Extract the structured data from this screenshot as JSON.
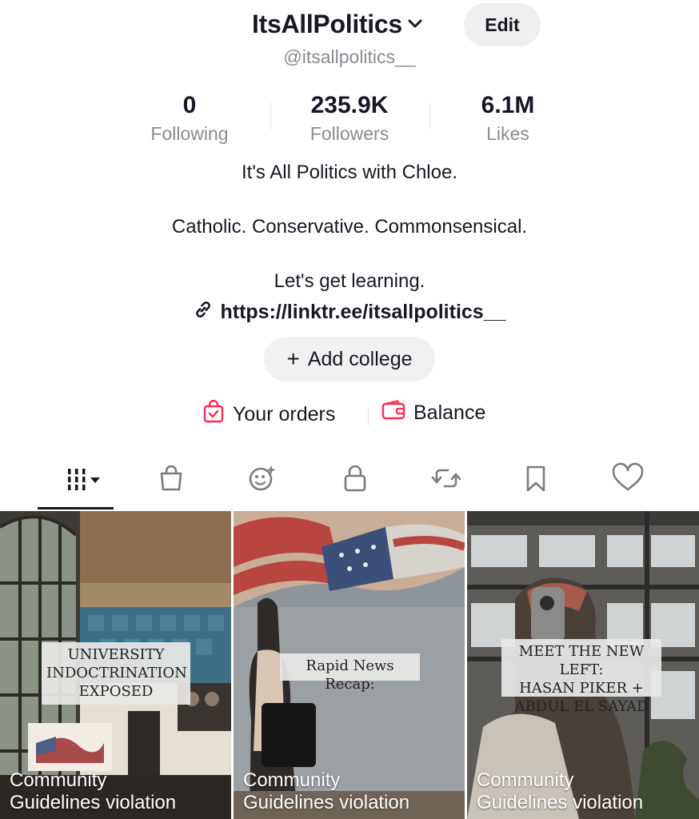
{
  "profile": {
    "display_name": "ItsAllPolitics",
    "edit_label": "Edit",
    "handle": "@itsallpolitics__"
  },
  "stats": [
    {
      "value": "0",
      "label": "Following"
    },
    {
      "value": "235.9K",
      "label": "Followers"
    },
    {
      "value": "6.1M",
      "label": "Likes"
    }
  ],
  "bio": {
    "line1": "It's All Politics with Chloe.",
    "line2": "Catholic. Conservative. Commonsensical.",
    "line3": "Let's get learning.",
    "link": "https://linktr.ee/itsallpolitics__"
  },
  "actions": {
    "add_college": "Add college",
    "orders": "Your orders",
    "balance": "Balance"
  },
  "tabs": [
    {
      "icon": "videos-grid-icon"
    },
    {
      "icon": "shop-bag-icon"
    },
    {
      "icon": "creator-icon"
    },
    {
      "icon": "lock-icon"
    },
    {
      "icon": "repost-icon"
    },
    {
      "icon": "bookmark-icon"
    },
    {
      "icon": "heart-icon"
    }
  ],
  "videos": [
    {
      "caption_lines": [
        "UNIVERSITY",
        "INDOCTRINATION",
        "EXPOSED"
      ],
      "status_line1": "Community",
      "status_line2": "Guidelines violation"
    },
    {
      "caption_lines": [
        "Rapid News Recap:"
      ],
      "status_line1": "Community",
      "status_line2": "Guidelines violation"
    },
    {
      "caption_lines": [
        "MEET THE NEW LEFT:",
        "HASAN PIKER +",
        "ABDUL EL SAYAD"
      ],
      "status_line1": "Community",
      "status_line2": "Guidelines violation"
    }
  ],
  "colors": {
    "accent": "#fe2c55",
    "text": "#161823",
    "muted": "#8a8b91"
  }
}
